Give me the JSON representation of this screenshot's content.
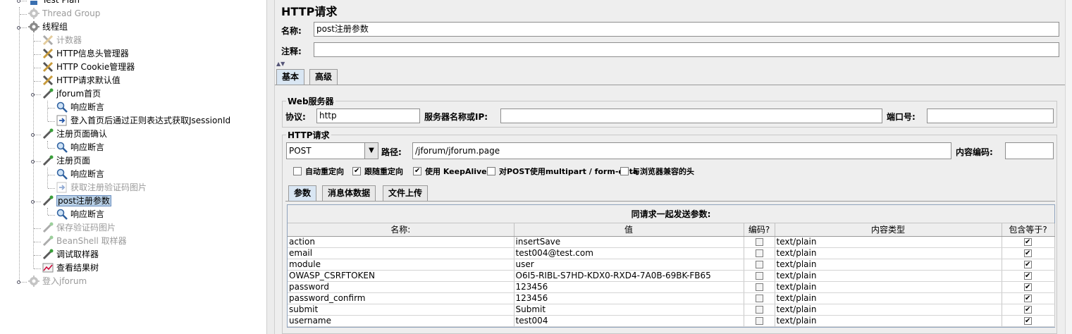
{
  "tree": {
    "nodes": [
      {
        "label": "Test Plan",
        "icon": "test-plan-icon",
        "disabled": false
      },
      {
        "label": "Thread Group",
        "icon": "gear-icon",
        "disabled": true
      },
      {
        "label": "线程组",
        "icon": "gear-icon",
        "disabled": false
      },
      {
        "label": "计数器",
        "icon": "wrench-icon",
        "disabled": true
      },
      {
        "label": "HTTP信息头管理器",
        "icon": "wrench-icon",
        "disabled": false
      },
      {
        "label": "HTTP Cookie管理器",
        "icon": "wrench-icon",
        "disabled": false
      },
      {
        "label": "HTTP请求默认值",
        "icon": "wrench-icon",
        "disabled": false
      },
      {
        "label": "jforum首页",
        "icon": "pipette-icon",
        "disabled": false
      },
      {
        "label": "响应断言",
        "icon": "magnifier-icon",
        "disabled": false
      },
      {
        "label": "登入首页后通过正则表达式获取JsessionId",
        "icon": "arrow-icon",
        "disabled": false
      },
      {
        "label": "注册页面确认",
        "icon": "pipette-icon",
        "disabled": false
      },
      {
        "label": "响应断言",
        "icon": "magnifier-icon",
        "disabled": false
      },
      {
        "label": "注册页面",
        "icon": "pipette-icon",
        "disabled": false
      },
      {
        "label": "响应断言",
        "icon": "magnifier-icon",
        "disabled": false
      },
      {
        "label": "获取注册验证码图片",
        "icon": "arrow-icon",
        "disabled": true
      },
      {
        "label": "post注册参数",
        "icon": "pipette-icon",
        "disabled": false
      },
      {
        "label": "响应断言",
        "icon": "magnifier-icon",
        "disabled": false
      },
      {
        "label": "保存验证码图片",
        "icon": "pipette-icon",
        "disabled": true
      },
      {
        "label": "BeanShell 取样器",
        "icon": "pipette-icon",
        "disabled": true
      },
      {
        "label": "调试取样器",
        "icon": "pipette-icon",
        "disabled": false
      },
      {
        "label": "查看结果树",
        "icon": "chart-icon",
        "disabled": false
      },
      {
        "label": "登入jforum",
        "icon": "gear-icon",
        "disabled": true
      }
    ]
  },
  "panel": {
    "title": "HTTP请求",
    "name_label": "名称:",
    "name_value": "post注册参数",
    "comment_label": "注释:",
    "comment_value": "",
    "tabs": [
      "基本",
      "高级"
    ],
    "web_server": {
      "title": "Web服务器",
      "protocol_label": "协议:",
      "protocol_value": "http",
      "server_label": "服务器名称或IP:",
      "server_value": "",
      "port_label": "端口号:",
      "port_value": ""
    },
    "http_request": {
      "title": "HTTP请求",
      "method": "POST",
      "path_label": "路径:",
      "path_value": "/jforum/jforum.page",
      "encoding_label": "内容编码:",
      "encoding_value": "",
      "options": [
        {
          "label": "自动重定向",
          "checked": false
        },
        {
          "label": "跟随重定向",
          "checked": true
        },
        {
          "label": "使用 KeepAlive",
          "checked": true
        },
        {
          "label": "对POST使用multipart / form-data",
          "checked": false
        },
        {
          "label": "与浏览器兼容的头",
          "checked": false
        }
      ]
    },
    "sub_tabs": [
      "参数",
      "消息体数据",
      "文件上传"
    ],
    "params_caption": "同请求一起发送参数:",
    "columns": [
      "名称:",
      "值",
      "编码?",
      "内容类型",
      "包含等于?"
    ],
    "rows": [
      {
        "name": "action",
        "value": "insertSave",
        "encode": false,
        "content_type": "text/plain",
        "include_equals": true
      },
      {
        "name": "email",
        "value": "test004@test.com",
        "encode": false,
        "content_type": "text/plain",
        "include_equals": true
      },
      {
        "name": "module",
        "value": "user",
        "encode": false,
        "content_type": "text/plain",
        "include_equals": true
      },
      {
        "name": "OWASP_CSRFTOKEN",
        "value": "O6I5-RIBL-S7HD-KDX0-RXD4-7A0B-69BK-FB65",
        "encode": false,
        "content_type": "text/plain",
        "include_equals": true
      },
      {
        "name": "password",
        "value": "123456",
        "encode": false,
        "content_type": "text/plain",
        "include_equals": true
      },
      {
        "name": "password_confirm",
        "value": "123456",
        "encode": false,
        "content_type": "text/plain",
        "include_equals": true
      },
      {
        "name": "submit",
        "value": "Submit",
        "encode": false,
        "content_type": "text/plain",
        "include_equals": true
      },
      {
        "name": "username",
        "value": "test004",
        "encode": false,
        "content_type": "text/plain",
        "include_equals": true
      }
    ]
  }
}
